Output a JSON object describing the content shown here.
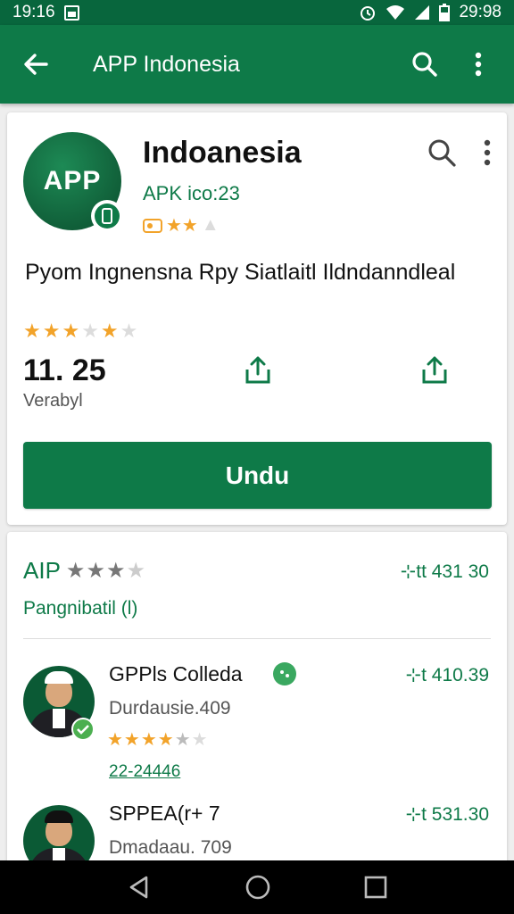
{
  "status_bar": {
    "time": "19:16",
    "clock_right": "29:98"
  },
  "app_bar": {
    "title": "APP Indonesia"
  },
  "app": {
    "logo_text": "APP",
    "name": "Indoanesia",
    "version": "APK ico:23",
    "description": "Pyom Ingnensna Rpy Siatlaitl Ildndanndleal",
    "size": "11. 25",
    "size_label": "Verabyl",
    "install_label": "Undu"
  },
  "reviews_header": {
    "title": "AIP",
    "price": "⊹tt 431 30",
    "subtitle": "Pangnibatil (l)"
  },
  "reviews": [
    {
      "name": "GPPls Colleda",
      "meta": "Durdausie.409",
      "price": "⊹t 410.39",
      "date": "22-24446"
    },
    {
      "name": "SPPEA(r+ 7",
      "meta": "Dmadaau. 709",
      "price": "⊹t 531.30"
    }
  ],
  "colors": {
    "primary": "#0e7a48",
    "status_bar": "#08663d",
    "star": "#f2a32a"
  }
}
